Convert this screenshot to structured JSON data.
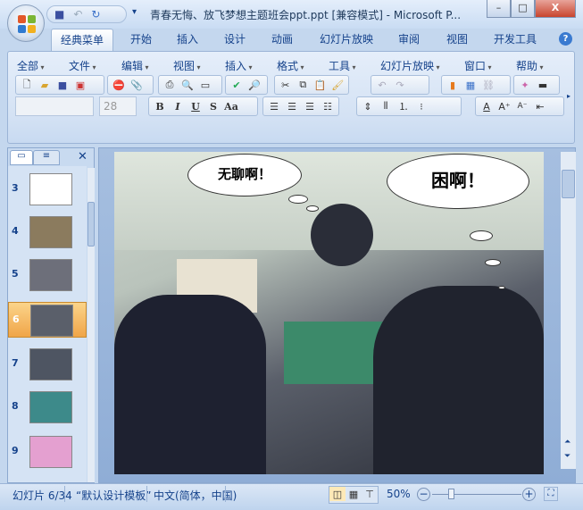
{
  "window": {
    "title": "青春无悔、放飞梦想主题班会ppt.ppt [兼容模式] - Microsoft P...",
    "minimize": "–",
    "maximize": "□",
    "close": "X"
  },
  "qat": {
    "save": "save-icon",
    "undo": "undo-icon",
    "redo": "redo-icon",
    "customize": "▾"
  },
  "tabs": [
    "经典菜单",
    "开始",
    "插入",
    "设计",
    "动画",
    "幻灯片放映",
    "审阅",
    "视图",
    "开发工具"
  ],
  "help": "?",
  "menus": [
    "全部",
    "文件",
    "编辑",
    "视图",
    "插入",
    "格式",
    "工具",
    "幻灯片放映",
    "窗口",
    "帮助"
  ],
  "format": {
    "font_name": "",
    "font_size": "28",
    "bold": "B",
    "italic": "I",
    "underline": "U",
    "shadow": "S",
    "case": "Aa"
  },
  "slides_pane": {
    "tabs": [
      "slides",
      "outline"
    ],
    "close": "✕",
    "items": [
      {
        "num": "3"
      },
      {
        "num": "4"
      },
      {
        "num": "5"
      },
      {
        "num": "6",
        "selected": true
      },
      {
        "num": "7"
      },
      {
        "num": "8"
      },
      {
        "num": "9"
      }
    ]
  },
  "slide": {
    "bubble1": "无聊啊！",
    "bubble2": "困啊！"
  },
  "status": {
    "slide": "幻灯片 6/34",
    "template": "“默认设计模板”",
    "language": "中文(简体，中国)",
    "zoom": "50%",
    "zoom_value": 50
  }
}
